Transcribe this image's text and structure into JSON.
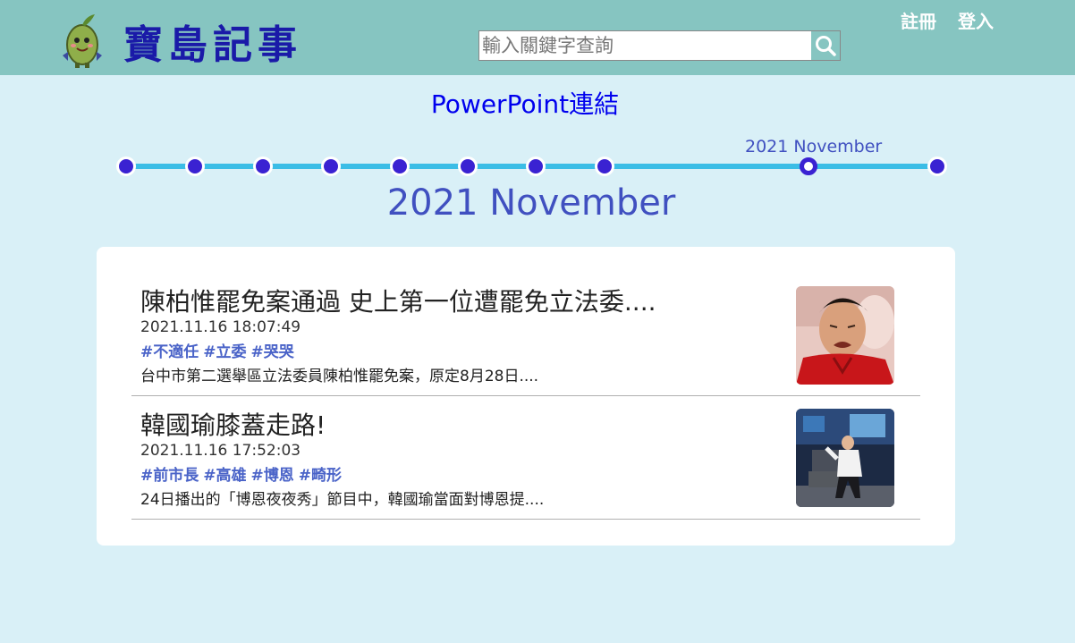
{
  "header": {
    "brand": "寶島記事",
    "search_placeholder": "輸入關鍵字查詢",
    "register_label": "註冊",
    "login_label": "登入"
  },
  "ppt_link": "PowerPoint連結",
  "timeline": {
    "dot_count": 10,
    "current_index": 8,
    "current_label": "2021 November"
  },
  "month_title": "2021 November",
  "articles": [
    {
      "title": "陳柏惟罷免案通過 史上第一位遭罷免立法委....",
      "datetime": "2021.11.16 18:07:49",
      "tags": [
        "#不適任",
        "#立委",
        "#哭哭"
      ],
      "summary": "台中市第二選舉區立法委員陳柏惟罷免案，原定8月28日...."
    },
    {
      "title": "韓國瑜膝蓋走路!",
      "datetime": "2021.11.16 17:52:03",
      "tags": [
        "#前市長",
        "#高雄",
        "#博恩",
        "#畸形"
      ],
      "summary": "24日播出的「博恩夜夜秀」節目中，韓國瑜當面對博恩提...."
    }
  ],
  "colors": {
    "header_bg": "#86c5c1",
    "page_bg": "#d9f0f7",
    "brand": "#1a1aa8",
    "accent_dot": "#3a22d2",
    "timeline_line": "#3bbde6",
    "tag": "#4a63c8"
  }
}
